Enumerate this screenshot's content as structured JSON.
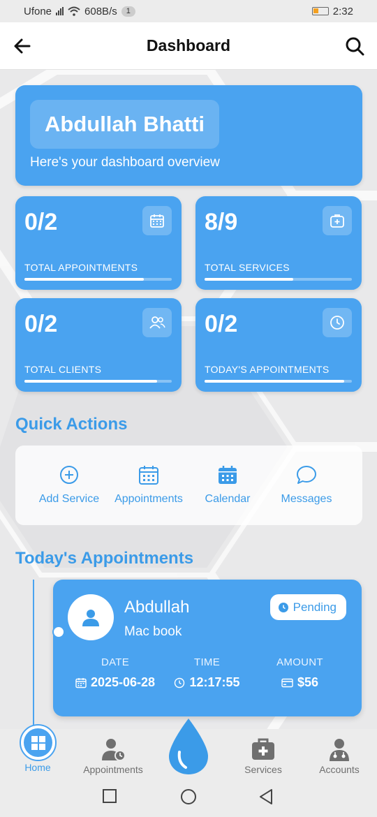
{
  "status_bar": {
    "carrier": "Ufone",
    "speed": "608B/s",
    "notification_count": "1",
    "time": "2:32"
  },
  "header": {
    "title": "Dashboard",
    "back_icon": "arrow-left-icon",
    "search_icon": "search-icon"
  },
  "welcome": {
    "name": "Abdullah Bhatti",
    "subtitle": "Here's your dashboard overview"
  },
  "stats": [
    {
      "value": "0/2",
      "label": "TOTAL APPOINTMENTS",
      "icon": "calendar-icon",
      "progress": 0.81
    },
    {
      "value": "8/9",
      "label": "TOTAL SERVICES",
      "icon": "medical-case-icon",
      "progress": 0.6
    },
    {
      "value": "0/2",
      "label": "TOTAL CLIENTS",
      "icon": "users-icon",
      "progress": 0.9
    },
    {
      "value": "0/2",
      "label": "TODAY'S APPOINTMENTS",
      "icon": "clock-icon",
      "progress": 0.95
    }
  ],
  "quick_actions": {
    "title": "Quick Actions",
    "items": [
      {
        "label": "Add Service",
        "icon": "plus-circle-icon"
      },
      {
        "label": "Appointments",
        "icon": "calendar-icon"
      },
      {
        "label": "Calendar",
        "icon": "calendar-filled-icon"
      },
      {
        "label": "Messages",
        "icon": "chat-bubble-icon"
      }
    ]
  },
  "todays_appointments": {
    "title": "Today's Appointments",
    "items": [
      {
        "client": "Abdullah",
        "service": "Mac book",
        "status": "Pending",
        "date_label": "DATE",
        "date": "2025-06-28",
        "time_label": "TIME",
        "time": "12:17:55",
        "amount_label": "AMOUNT",
        "amount": "$56"
      }
    ]
  },
  "bottom_nav": {
    "items": [
      {
        "label": "Home",
        "icon": "home-grid-icon",
        "active": true
      },
      {
        "label": "Appointments",
        "icon": "user-clock-icon"
      },
      {
        "label": "",
        "icon": "water-drop-icon"
      },
      {
        "label": "Services",
        "icon": "medical-case-icon"
      },
      {
        "label": "Accounts",
        "icon": "doctor-icon"
      }
    ]
  },
  "colors": {
    "primary": "#4aa3f0",
    "accent_text": "#3b9be8",
    "background": "#e9e9ea"
  }
}
